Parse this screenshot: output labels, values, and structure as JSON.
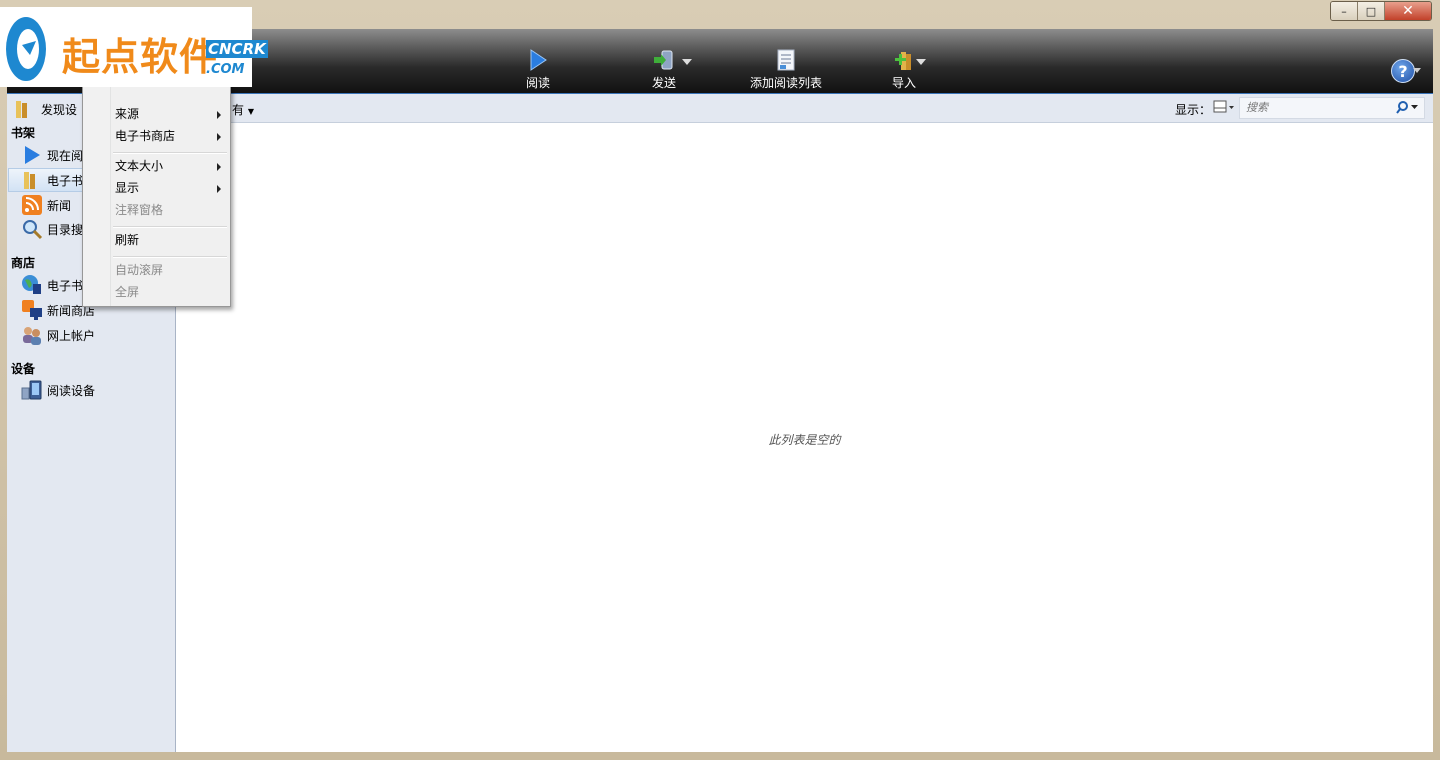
{
  "window": {
    "minimize_icon": "minimize-icon",
    "maximize_icon": "maximize-icon",
    "close_icon": "close-icon"
  },
  "logo": {
    "title": "起点软件",
    "badge": "CNCRK",
    "domain": ".COM"
  },
  "toolbar": {
    "buttons": [
      {
        "label": "阅读",
        "icon": "play-icon"
      },
      {
        "label": "发送",
        "icon": "send-device-icon"
      },
      {
        "label": "添加阅读列表",
        "icon": "add-list-icon"
      },
      {
        "label": "导入",
        "icon": "import-icon"
      }
    ],
    "help_label": "?"
  },
  "sidebar": {
    "top_item": "发现设",
    "sections": [
      {
        "heading": "书架",
        "items": [
          "现在阅",
          "电子书",
          "新闻",
          "目录搜"
        ]
      },
      {
        "heading": "商店",
        "items": [
          "电子书",
          "新闻商店",
          "网上帐户"
        ]
      },
      {
        "heading": "设备",
        "items": [
          "阅读设备"
        ]
      }
    ]
  },
  "filterbar": {
    "filter_value": "有",
    "view_label": "显示：",
    "search_placeholder": "搜索"
  },
  "content": {
    "empty_message": "此列表是空的"
  },
  "menu": {
    "items": [
      {
        "label": "来源",
        "enabled": true,
        "submenu": true
      },
      {
        "label": "电子书商店",
        "enabled": true,
        "submenu": true
      },
      {
        "label": "文本大小",
        "enabled": true,
        "submenu": true
      },
      {
        "label": "显示",
        "enabled": true,
        "submenu": true
      },
      {
        "label": "注释窗格",
        "enabled": false,
        "submenu": false
      },
      {
        "label": "刷新",
        "enabled": true,
        "submenu": false
      },
      {
        "label": "自动滚屏",
        "enabled": false,
        "submenu": false
      },
      {
        "label": "全屏",
        "enabled": false,
        "submenu": false
      }
    ]
  },
  "colors": {
    "accent": "#3a74b8",
    "logo_orange": "#f08a1a",
    "logo_blue": "#1e88d0",
    "sidebar_bg": "#e3e8f1"
  }
}
